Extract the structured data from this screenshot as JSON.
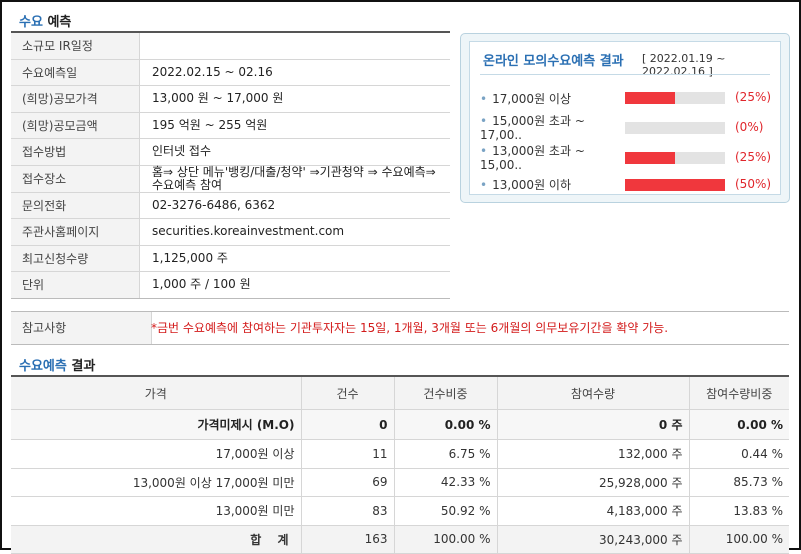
{
  "info_section": {
    "title_blue": "수요",
    "title_rest": " 예측"
  },
  "info_rows": [
    {
      "label": "소규모 IR일정",
      "value": ""
    },
    {
      "label": "수요예측일",
      "value": "2022.02.15 ~ 02.16"
    },
    {
      "label": "(희망)공모가격",
      "value": "13,000 원 ~ 17,000 원"
    },
    {
      "label": "(희망)공모금액",
      "value": "195 억원 ~ 255 억원"
    },
    {
      "label": "접수방법",
      "value": "인터넷 접수"
    },
    {
      "label": "접수장소",
      "value": "홈⇒ 상단 메뉴'뱅킹/대출/청약' ⇒기관청약 ⇒ 수요예측⇒ 수요예측 참여"
    },
    {
      "label": "문의전화",
      "value": "02-3276-6486, 6362"
    },
    {
      "label": "주관사홈페이지",
      "value": "securities.koreainvestment.com"
    },
    {
      "label": "최고신청수량",
      "value": "1,125,000 주"
    },
    {
      "label": "단위",
      "value": "1,000 주 / 100 원"
    }
  ],
  "mock": {
    "title": "온라인 모의수요예측 결과",
    "range": "[ 2022.01.19 ~ 2022.02.16 ]",
    "items": [
      {
        "label": "17,000원 이상",
        "percent": 25,
        "percent_label": "(25%)"
      },
      {
        "label": "15,000원 초과 ~ 17,00..",
        "percent": 0,
        "percent_label": "(0%)"
      },
      {
        "label": "13,000원 초과 ~ 15,00..",
        "percent": 25,
        "percent_label": "(25%)"
      },
      {
        "label": "13,000원 이하",
        "percent": 50,
        "percent_label": "(50%)"
      }
    ]
  },
  "note": {
    "label": "참고사항",
    "text": "*금번 수요예측에 참여하는 기관투자자는 15일, 1개월, 3개월 또는 6개월의 의무보유기간을 확약 가능."
  },
  "result_section": {
    "title_blue": "수요예측",
    "title_rest": " 결과"
  },
  "result_table": {
    "headers": [
      "가격",
      "건수",
      "건수비중",
      "참여수량",
      "참여수량비중"
    ],
    "rows": [
      [
        "가격미제시 (M.O)",
        "0",
        "0.00 %",
        "0 주",
        "0.00 %"
      ],
      [
        "17,000원 이상",
        "11",
        "6.75 %",
        "132,000 주",
        "0.44 %"
      ],
      [
        "13,000원 이상 17,000원 미만",
        "69",
        "42.33 %",
        "25,928,000 주",
        "85.73 %"
      ],
      [
        "13,000원 미만",
        "83",
        "50.92 %",
        "4,183,000 주",
        "13.83 %"
      ],
      [
        "합 계",
        "163",
        "100.00 %",
        "30,243,000 주",
        "100.00 %"
      ]
    ]
  },
  "colors": {
    "accent_blue": "#2a6fb3",
    "bar_red": "#f0373d",
    "note_red": "#d31a1a"
  }
}
